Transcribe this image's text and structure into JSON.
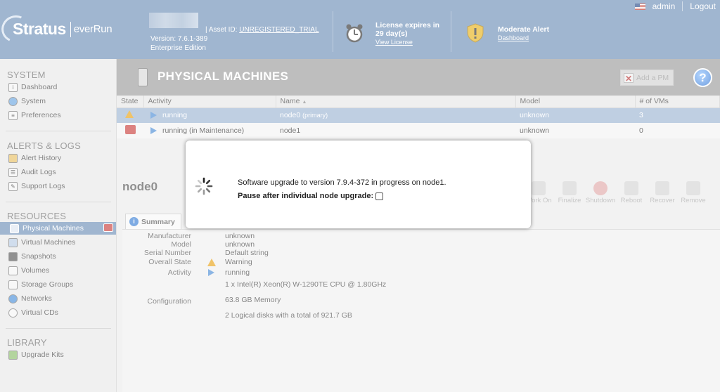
{
  "header": {
    "brand": "Stratus",
    "product": "everRun",
    "version": "Version: 7.6.1-389",
    "edition": "Enterprise Edition",
    "asset_label": "Asset ID:",
    "asset_link": "UNREGISTERED_TRIAL",
    "license_line1": "License expires in",
    "license_line2": "29 day(s)",
    "license_link": "View License",
    "alert_title": "Moderate Alert",
    "alert_link": "Dashboard",
    "user": "admin",
    "logout": "Logout"
  },
  "sidebar": {
    "system_title": "SYSTEM",
    "system_items": [
      {
        "label": "Dashboard",
        "icon": "dashboard-icon"
      },
      {
        "label": "System",
        "icon": "globe-icon"
      },
      {
        "label": "Preferences",
        "icon": "preferences-icon"
      }
    ],
    "alerts_title": "ALERTS & LOGS",
    "alerts_items": [
      {
        "label": "Alert History",
        "icon": "bell-icon"
      },
      {
        "label": "Audit Logs",
        "icon": "clipboard-icon"
      },
      {
        "label": "Support Logs",
        "icon": "notepad-icon"
      }
    ],
    "resources_title": "RESOURCES",
    "resources_items": [
      {
        "label": "Physical Machines",
        "icon": "server-icon"
      },
      {
        "label": "Virtual Machines",
        "icon": "vm-icon"
      },
      {
        "label": "Snapshots",
        "icon": "camera-icon"
      },
      {
        "label": "Volumes",
        "icon": "volume-icon"
      },
      {
        "label": "Storage Groups",
        "icon": "storage-icon"
      },
      {
        "label": "Networks",
        "icon": "network-icon"
      },
      {
        "label": "Virtual CDs",
        "icon": "cd-icon"
      }
    ],
    "library_title": "LIBRARY",
    "library_items": [
      {
        "label": "Upgrade Kits",
        "icon": "upgrade-kit-icon"
      }
    ]
  },
  "main": {
    "title": "PHYSICAL MACHINES",
    "add_pm": "Add a PM",
    "columns": [
      "State",
      "Activity",
      "Name",
      "Model",
      "# of VMs"
    ],
    "name_sort": "▲",
    "rows": [
      {
        "activity": "running",
        "name": "node0",
        "name_note": "(primary)",
        "model": "unknown",
        "vms": "3"
      },
      {
        "activity": "running (in Maintenance)",
        "name": "node1",
        "name_note": "",
        "model": "unknown",
        "vms": "0"
      }
    ],
    "node_title": "node0",
    "actions": [
      "Work On",
      "Finalize",
      "Shutdown",
      "Reboot",
      "Recover",
      "Remove"
    ],
    "summary_tab": "Summary",
    "summary": {
      "manufacturer_label": "Manufacturer",
      "manufacturer": "unknown",
      "model_label": "Model",
      "model": "unknown",
      "serial_label": "Serial Number",
      "serial": "Default string",
      "state_label": "Overall State",
      "state": "Warning",
      "activity_label": "Activity",
      "activity": "running",
      "cpu": "1 x Intel(R) Xeon(R) W-1290TE CPU @ 1.80GHz",
      "config_label": "Configuration",
      "memory": "63.8 GB Memory",
      "disks": "2 Logical disks with a total of 921.7 GB"
    }
  },
  "modal": {
    "message": "Software upgrade to version 7.9.4-372 in progress on node1.",
    "pause_label": "Pause after individual node upgrade:"
  },
  "colors": {
    "header": "#6d8fb7",
    "selected_row": "#9db5d3",
    "warning": "#e8a317",
    "maintenance": "#c9403c"
  }
}
